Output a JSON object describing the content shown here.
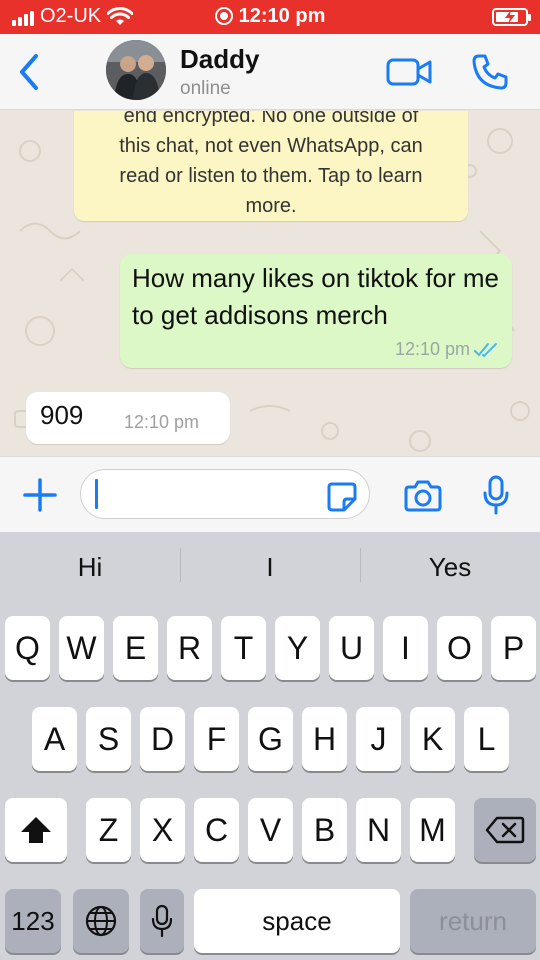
{
  "status_bar": {
    "carrier": "O2-UK",
    "time": "12:10 pm",
    "bg_color": "#e8312b"
  },
  "header": {
    "contact_name": "Daddy",
    "contact_status": "online",
    "back_icon": "chevron-left-icon",
    "video_icon": "video-camera-icon",
    "call_icon": "phone-icon",
    "accent_color": "#1a7cf5"
  },
  "chat": {
    "encryption_notice_lines": [
      "end encrypted. No one outside of",
      "this chat, not even WhatsApp, can",
      "read or listen to them. Tap to learn",
      "more."
    ],
    "messages": [
      {
        "direction": "outgoing",
        "text": "How many likes on tiktok for me to get addisons merch",
        "time": "12:10 pm",
        "read": true
      },
      {
        "direction": "incoming",
        "text": "909",
        "time": "12:10 pm"
      }
    ]
  },
  "input_bar": {
    "value": "",
    "plus_icon": "plus-icon",
    "sticker_icon": "sticker-icon",
    "camera_icon": "camera-icon",
    "mic_icon": "microphone-icon"
  },
  "keyboard": {
    "suggestions": [
      "Hi",
      "I",
      "Yes"
    ],
    "row1": [
      "Q",
      "W",
      "E",
      "R",
      "T",
      "Y",
      "U",
      "I",
      "O",
      "P"
    ],
    "row2": [
      "A",
      "S",
      "D",
      "F",
      "G",
      "H",
      "J",
      "K",
      "L"
    ],
    "row3": [
      "Z",
      "X",
      "C",
      "V",
      "B",
      "N",
      "M"
    ],
    "numbers_label": "123",
    "space_label": "space",
    "return_label": "return",
    "shift_icon": "shift-icon",
    "backspace_icon": "backspace-icon",
    "globe_icon": "globe-icon",
    "dictation_icon": "microphone-icon"
  }
}
